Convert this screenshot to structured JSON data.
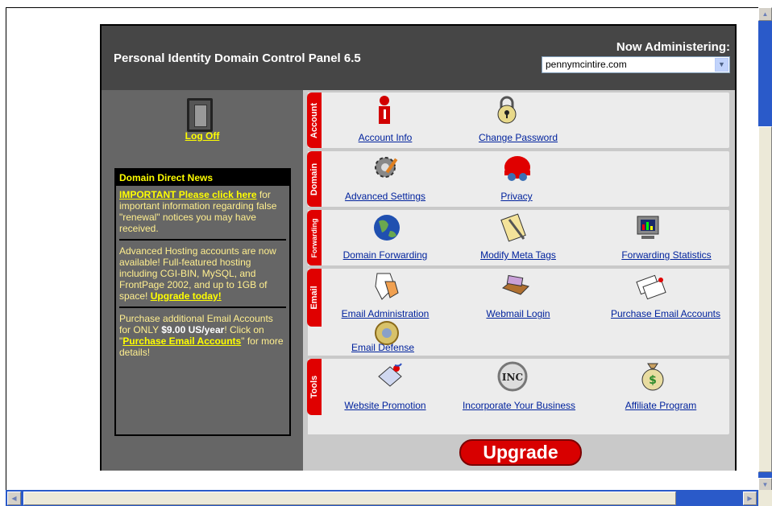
{
  "header": {
    "title": "Personal Identity Domain Control Panel 6.5",
    "now_administering": "Now Administering:",
    "domain_value": "pennymcintire.com"
  },
  "sidebar": {
    "logoff_label": "Log Off",
    "news_title": "Domain Direct News",
    "news1_link": "IMPORTANT Please click here",
    "news1_text": " for important information regarding false \"renewal\" notices you may have received.",
    "news2_text": "Advanced Hosting accounts are now available! Full-featured hosting including CGI-BIN, MySQL, and FrontPage 2002, and up to 1GB of space! ",
    "news2_link": "Upgrade today!",
    "news3_text_a": "Purchase additional Email Accounts for ONLY ",
    "news3_price": "$9.00 US/year",
    "news3_text_b": "! Click on \"",
    "news3_link": "Purchase Email Accounts",
    "news3_text_c": "\" for more details!"
  },
  "sections": {
    "account": {
      "tab": "Account",
      "items": [
        "Account Info",
        "Change Password"
      ]
    },
    "domain": {
      "tab": "Domain",
      "items": [
        "Advanced Settings",
        "Privacy"
      ]
    },
    "forwarding": {
      "tab": "Forwarding",
      "items": [
        "Domain Forwarding",
        "Modify Meta Tags",
        "Forwarding Statistics"
      ]
    },
    "email": {
      "tab": "Email",
      "items": [
        "Email Administration",
        "Webmail Login",
        "Purchase Email Accounts",
        "Email Defense"
      ]
    },
    "tools": {
      "tab": "Tools",
      "items": [
        "Website Promotion",
        "Incorporate Your Business",
        "Affiliate Program"
      ]
    }
  },
  "upgrade_label": "Upgrade",
  "colors": {
    "tab_red": "#e00000",
    "link_blue": "#00229d",
    "news_yellow": "#ffff00"
  }
}
